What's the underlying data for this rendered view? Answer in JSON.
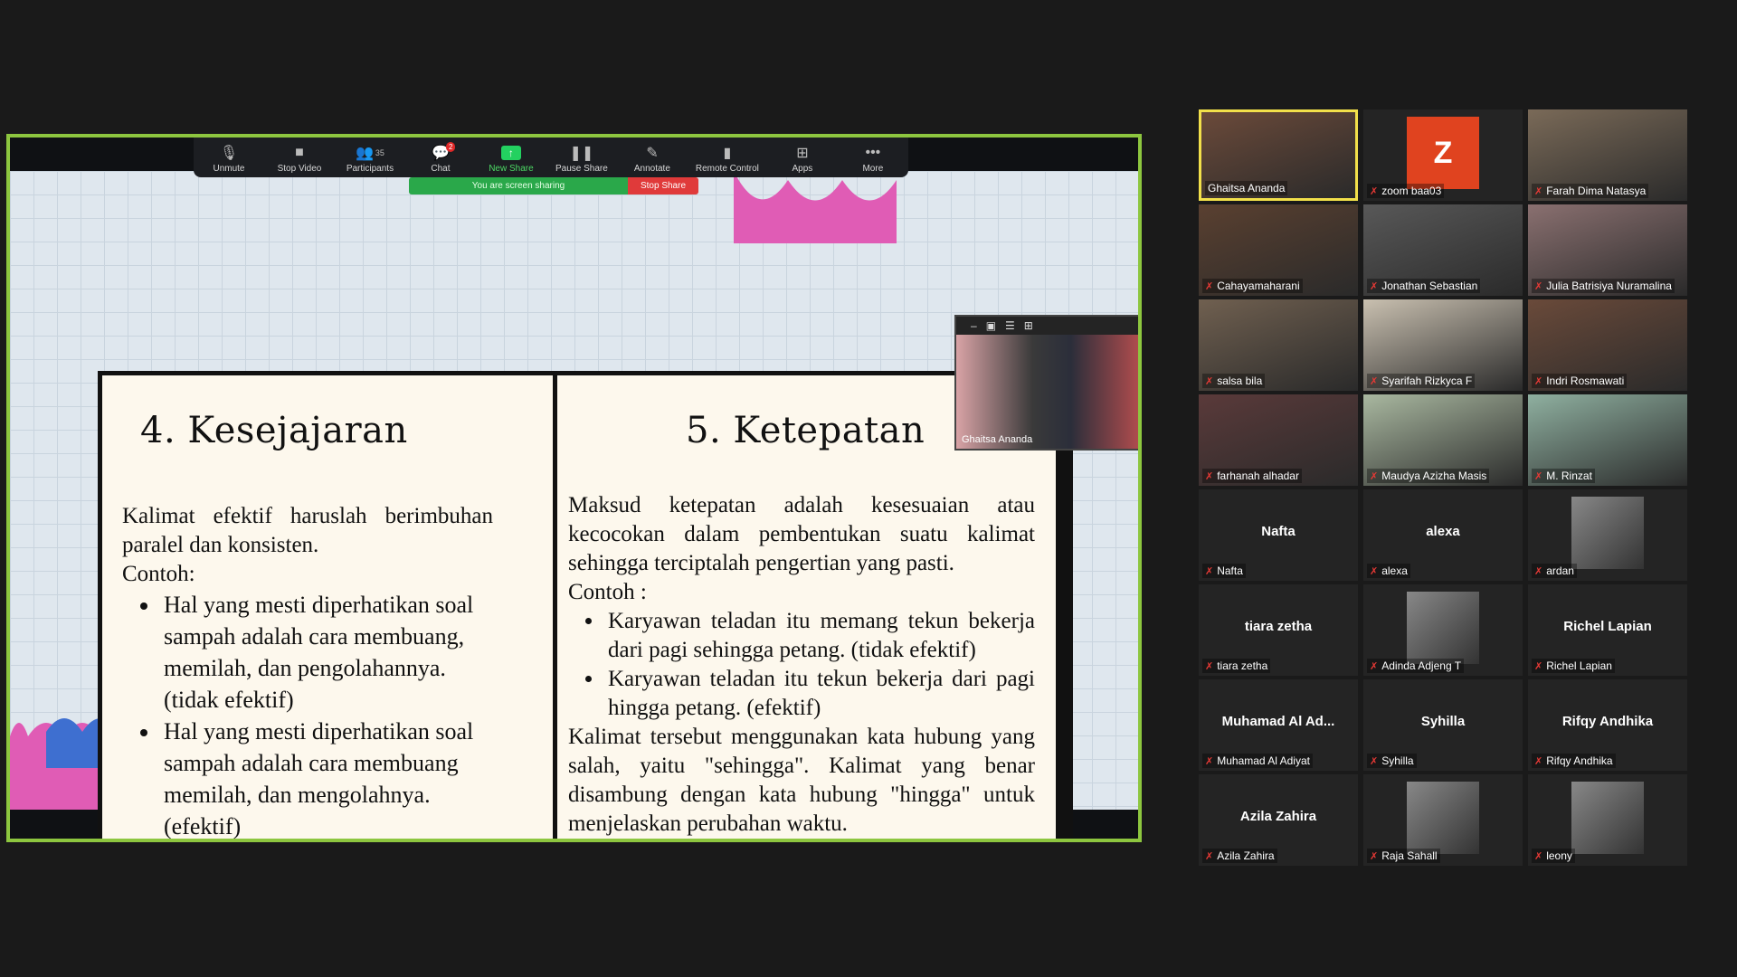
{
  "toolbar": {
    "items": [
      {
        "key": "unmute",
        "label": "Unmute",
        "icon": "mic-muted-icon"
      },
      {
        "key": "stop_video",
        "label": "Stop Video",
        "icon": "video-camera-icon"
      },
      {
        "key": "participants",
        "label": "Participants",
        "icon": "participants-icon",
        "count": "35"
      },
      {
        "key": "chat",
        "label": "Chat",
        "icon": "chat-icon",
        "badge": "2"
      },
      {
        "key": "new_share",
        "label": "New Share",
        "icon": "share-screen-icon"
      },
      {
        "key": "pause_share",
        "label": "Pause Share",
        "icon": "pause-icon"
      },
      {
        "key": "annotate",
        "label": "Annotate",
        "icon": "pencil-icon"
      },
      {
        "key": "remote_control",
        "label": "Remote Control",
        "icon": "mouse-icon"
      },
      {
        "key": "apps",
        "label": "Apps",
        "icon": "apps-icon"
      },
      {
        "key": "more",
        "label": "More",
        "icon": "more-dots-icon"
      }
    ]
  },
  "sharing": {
    "status": "You are screen sharing",
    "stop_label": "Stop Share"
  },
  "slide": {
    "left": {
      "title": "4. Kesejajaran",
      "intro": "Kalimat efektif haruslah berimbuhan paralel dan konsisten.",
      "contoh": "Contoh:",
      "bullets": [
        "Hal yang mesti diperhatikan soal sampah adalah cara membuang, memilah, dan pengolahannya.(tidak efektif)",
        "Hal yang mesti diperhatikan soal sampah adalah cara membuang memilah, dan mengolahnya. (efektif)"
      ]
    },
    "right": {
      "title": "5. Ketepatan",
      "intro": "Maksud ketepatan adalah kesesuaian atau kecocokan dalam pembentukan suatu kalimat sehingga terciptalah pengertian yang pasti.",
      "contoh": "Contoh :",
      "bullets": [
        "Karyawan teladan itu memang tekun bekerja dari pagi sehingga petang. (tidak efektif)",
        "Karyawan teladan itu tekun bekerja dari pagi hingga petang. (efektif)"
      ],
      "outro": "Kalimat tersebut menggunakan kata hubung yang salah, yaitu \"sehingga\". Kalimat yang benar disambung dengan kata hubung \"hingga\" untuk menjelaskan perubahan waktu."
    }
  },
  "self_view": {
    "name": "Ghaitsa Ananda"
  },
  "participants": [
    {
      "name": "Ghaitsa Ananda",
      "video": true,
      "active": true
    },
    {
      "name": "zoom baa03",
      "avatar_letter": "Z"
    },
    {
      "name": "Farah Dima Natasya",
      "video": true
    },
    {
      "name": "Cahayamaharani",
      "video": true
    },
    {
      "name": "Jonathan Sebastian",
      "video": true
    },
    {
      "name": "Julia Batrisiya Nuramalina",
      "video": true
    },
    {
      "name": "salsa bila",
      "video": true
    },
    {
      "name": "Syarifah Rizkyca F",
      "video": true
    },
    {
      "name": "Indri Rosmawati",
      "video": true
    },
    {
      "name": "farhanah alhadar",
      "video": true
    },
    {
      "name": "Maudya Azizha Masis",
      "video": true
    },
    {
      "name": "M. Rinzat",
      "video": true
    },
    {
      "name": "Nafta",
      "display": "Nafta"
    },
    {
      "name": "alexa",
      "display": "alexa"
    },
    {
      "name": "ardan",
      "avatar": true
    },
    {
      "name": "tiara zetha",
      "display": "tiara zetha"
    },
    {
      "name": "Adinda Adjeng T",
      "avatar": true
    },
    {
      "name": "Richel Lapian",
      "display": "Richel Lapian"
    },
    {
      "name": "Muhamad Al Adiyat",
      "display": "Muhamad Al Ad..."
    },
    {
      "name": "Syhilla",
      "display": "Syhilla"
    },
    {
      "name": "Rifqy Andhika",
      "display": "Rifqy Andhika"
    },
    {
      "name": "Azila Zahira",
      "display": "Azila Zahira"
    },
    {
      "name": "Raja Sahall",
      "avatar": true
    },
    {
      "name": "leony",
      "avatar": true
    }
  ],
  "colors": {
    "share_border": "#8dc63f",
    "active_speaker": "#f2e04a",
    "muted": "#e53935",
    "new_share": "#23d160"
  }
}
